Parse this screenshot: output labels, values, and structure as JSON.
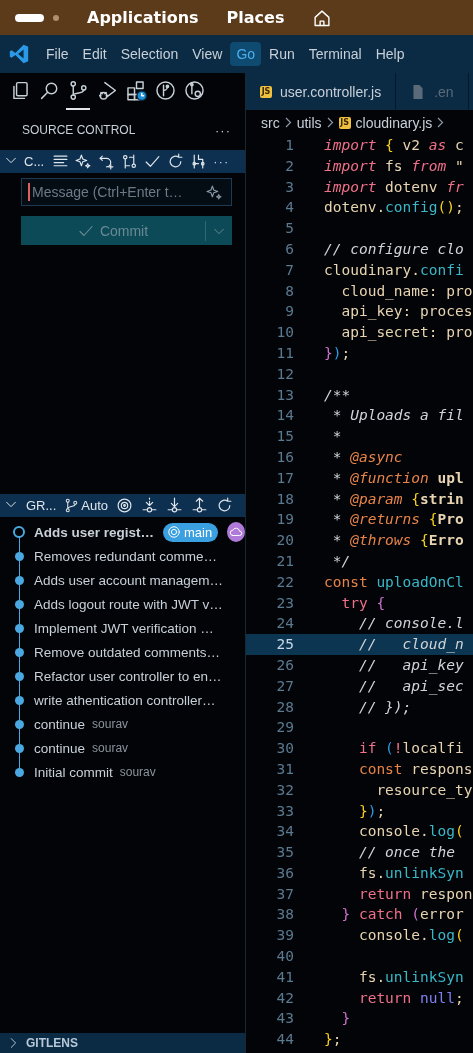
{
  "top_bar": {
    "menus": [
      "Applications",
      "Places"
    ]
  },
  "menu_bar": {
    "items": [
      {
        "label": "File",
        "selected": false
      },
      {
        "label": "Edit",
        "selected": false
      },
      {
        "label": "Selection",
        "selected": false
      },
      {
        "label": "View",
        "selected": false
      },
      {
        "label": "Go",
        "selected": true
      },
      {
        "label": "Run",
        "selected": false
      },
      {
        "label": "Terminal",
        "selected": false
      },
      {
        "label": "Help",
        "selected": false
      }
    ]
  },
  "activity_bar": {
    "items": [
      {
        "kind": "explorer",
        "selected": false
      },
      {
        "kind": "search",
        "selected": false
      },
      {
        "kind": "source_control",
        "selected": true
      },
      {
        "kind": "run",
        "selected": false
      },
      {
        "kind": "extensions",
        "selected": false
      },
      {
        "kind": "graph",
        "selected": false
      },
      {
        "kind": "inspect",
        "selected": false
      }
    ]
  },
  "source_control": {
    "title": "SOURCE CONTROL",
    "more": "···",
    "repo_header": {
      "expanded": true,
      "label": "C...",
      "more": "···"
    },
    "message": {
      "placeholder": "Message (Ctrl+Enter t…"
    },
    "commit_button": {
      "label": "Commit",
      "disabled": true
    }
  },
  "graph": {
    "header": {
      "expanded": true,
      "label": "GR...",
      "mode": "Auto"
    },
    "commits": [
      {
        "message": "Adds user regist…",
        "head": true,
        "branch": "main"
      },
      {
        "message": "Removes redundant comme…",
        "head": false
      },
      {
        "message": "Adds user account managem…",
        "head": false
      },
      {
        "message": "Adds logout route with JWT v…",
        "head": false
      },
      {
        "message": "Implement JWT verification …",
        "head": false
      },
      {
        "message": "Remove outdated comments…",
        "head": false
      },
      {
        "message": "Refactor user controller to en…",
        "head": false
      },
      {
        "message": "write athentication controller…",
        "head": false
      },
      {
        "message": "continue",
        "head": false,
        "author": "sourav"
      },
      {
        "message": "continue",
        "head": false,
        "author": "sourav"
      },
      {
        "message": "Initial commit",
        "head": false,
        "author": "sourav"
      }
    ]
  },
  "gitlens": {
    "label": "GITLENS",
    "expanded": false
  },
  "tabs": [
    {
      "label": "user.controller.js",
      "kind": "js",
      "icon_text": "JS",
      "selected": false
    },
    {
      "label": ".en",
      "kind": "file",
      "selected": false
    }
  ],
  "breadcrumb": [
    {
      "label": "src"
    },
    {
      "label": "utils"
    },
    {
      "label": "cloudinary.js",
      "icon_text": "JS"
    }
  ],
  "code_lines": [
    {
      "number": "1",
      "current": false,
      "tokens": [
        {
          "text": "import",
          "kind": "kw"
        },
        {
          "text": " {",
          "kind": "b1"
        },
        {
          "text": " v2 ",
          "kind": "id"
        },
        {
          "text": "as",
          "kind": "kw"
        },
        {
          "text": " c",
          "kind": "id"
        }
      ]
    },
    {
      "number": "2",
      "current": false,
      "tokens": [
        {
          "text": "import",
          "kind": "kw"
        },
        {
          "text": " fs ",
          "kind": "id"
        },
        {
          "text": "from",
          "kind": "kw"
        },
        {
          "text": " \"",
          "kind": "id"
        }
      ]
    },
    {
      "number": "3",
      "current": false,
      "tokens": [
        {
          "text": "import",
          "kind": "kw"
        },
        {
          "text": " dotenv ",
          "kind": "id"
        },
        {
          "text": "fr",
          "kind": "kw"
        }
      ]
    },
    {
      "number": "4",
      "current": false,
      "tokens": [
        {
          "text": "dotenv.",
          "kind": "id"
        },
        {
          "text": "config",
          "kind": "fn"
        },
        {
          "text": "()",
          "kind": "b1"
        },
        {
          "text": ";",
          "kind": "id"
        }
      ]
    },
    {
      "number": "5",
      "current": false
    },
    {
      "number": "6",
      "current": false,
      "tokens": [
        {
          "text": "// configure clo",
          "kind": "cm"
        }
      ]
    },
    {
      "number": "7",
      "current": false,
      "tokens": [
        {
          "text": "cloudinary.",
          "kind": "id"
        },
        {
          "text": "confi",
          "kind": "fn"
        }
      ]
    },
    {
      "number": "8",
      "current": false,
      "tokens": [
        {
          "text": "  cloud_name: pro",
          "kind": "id"
        }
      ]
    },
    {
      "number": "9",
      "current": false,
      "tokens": [
        {
          "text": "  api_key: proces",
          "kind": "id"
        }
      ]
    },
    {
      "number": "10",
      "current": false,
      "tokens": [
        {
          "text": "  api_secret: pro",
          "kind": "id"
        }
      ]
    },
    {
      "number": "11",
      "current": false,
      "tokens": [
        {
          "text": "}",
          "kind": "b2"
        },
        {
          "text": ")",
          "kind": "b3"
        },
        {
          "text": ";",
          "kind": "id"
        }
      ]
    },
    {
      "number": "12",
      "current": false
    },
    {
      "number": "13",
      "current": false,
      "tokens": [
        {
          "text": "/**",
          "kind": "cm"
        }
      ]
    },
    {
      "number": "14",
      "current": false,
      "tokens": [
        {
          "text": " * Uploads a fil",
          "kind": "cm"
        }
      ]
    },
    {
      "number": "15",
      "current": false,
      "tokens": [
        {
          "text": " *",
          "kind": "cm"
        }
      ]
    },
    {
      "number": "16",
      "current": false,
      "tokens": [
        {
          "text": " * ",
          "kind": "cm"
        },
        {
          "text": "@async",
          "kind": "tag"
        }
      ]
    },
    {
      "number": "17",
      "current": false,
      "tokens": [
        {
          "text": " * ",
          "kind": "cm"
        },
        {
          "text": "@function",
          "kind": "tag"
        },
        {
          "text": " upl",
          "kind": "ty"
        }
      ]
    },
    {
      "number": "18",
      "current": false,
      "tokens": [
        {
          "text": " * ",
          "kind": "cm"
        },
        {
          "text": "@param",
          "kind": "tag"
        },
        {
          "text": " {",
          "kind": "b1"
        },
        {
          "text": "strin",
          "kind": "ty"
        }
      ]
    },
    {
      "number": "19",
      "current": false,
      "tokens": [
        {
          "text": " * ",
          "kind": "cm"
        },
        {
          "text": "@returns",
          "kind": "tag"
        },
        {
          "text": " {",
          "kind": "b1"
        },
        {
          "text": "Pro",
          "kind": "ty"
        }
      ]
    },
    {
      "number": "20",
      "current": false,
      "tokens": [
        {
          "text": " * ",
          "kind": "cm"
        },
        {
          "text": "@throws",
          "kind": "tag"
        },
        {
          "text": " {",
          "kind": "b1"
        },
        {
          "text": "Erro",
          "kind": "ty"
        }
      ]
    },
    {
      "number": "21",
      "current": false,
      "tokens": [
        {
          "text": " */",
          "kind": "cm"
        }
      ]
    },
    {
      "number": "22",
      "current": false,
      "tokens": [
        {
          "text": "const",
          "kind": "cst"
        },
        {
          "text": " uploadOnCl",
          "kind": "fn"
        }
      ]
    },
    {
      "number": "23",
      "current": false,
      "tokens": [
        {
          "text": "  try",
          "kind": "ctl"
        },
        {
          "text": " {",
          "kind": "b2"
        }
      ]
    },
    {
      "number": "24",
      "current": false,
      "tokens": [
        {
          "text": "    // console.l",
          "kind": "cm"
        }
      ]
    },
    {
      "number": "25",
      "current": true,
      "tokens": [
        {
          "text": "    //   cloud_n",
          "kind": "cm"
        }
      ]
    },
    {
      "number": "26",
      "current": false,
      "tokens": [
        {
          "text": "    //   api_key",
          "kind": "cm"
        }
      ]
    },
    {
      "number": "27",
      "current": false,
      "tokens": [
        {
          "text": "    //   api_sec",
          "kind": "cm"
        }
      ]
    },
    {
      "number": "28",
      "current": false,
      "tokens": [
        {
          "text": "    // });",
          "kind": "cm"
        }
      ]
    },
    {
      "number": "29",
      "current": false
    },
    {
      "number": "30",
      "current": false,
      "tokens": [
        {
          "text": "    if",
          "kind": "ctl"
        },
        {
          "text": " (",
          "kind": "b3"
        },
        {
          "text": "!",
          "kind": "ctl"
        },
        {
          "text": "localfi",
          "kind": "id"
        }
      ]
    },
    {
      "number": "31",
      "current": false,
      "tokens": [
        {
          "text": "    const",
          "kind": "cst"
        },
        {
          "text": " respons",
          "kind": "id"
        }
      ]
    },
    {
      "number": "32",
      "current": false,
      "tokens": [
        {
          "text": "      resource_ty",
          "kind": "id"
        }
      ]
    },
    {
      "number": "33",
      "current": false,
      "tokens": [
        {
          "text": "    }",
          "kind": "b1"
        },
        {
          "text": ")",
          "kind": "b3"
        },
        {
          "text": ";",
          "kind": "id"
        }
      ]
    },
    {
      "number": "34",
      "current": false,
      "tokens": [
        {
          "text": "    console.",
          "kind": "id"
        },
        {
          "text": "log",
          "kind": "fn"
        },
        {
          "text": "(",
          "kind": "b1"
        }
      ]
    },
    {
      "number": "35",
      "current": false,
      "tokens": [
        {
          "text": "    // once the",
          "kind": "cm"
        }
      ]
    },
    {
      "number": "36",
      "current": false,
      "tokens": [
        {
          "text": "    fs.",
          "kind": "id"
        },
        {
          "text": "unlinkSyn",
          "kind": "fn"
        }
      ]
    },
    {
      "number": "37",
      "current": false,
      "tokens": [
        {
          "text": "    return",
          "kind": "ctl"
        },
        {
          "text": " respon",
          "kind": "id"
        }
      ]
    },
    {
      "number": "38",
      "current": false,
      "tokens": [
        {
          "text": "  }",
          "kind": "b2"
        },
        {
          "text": " catch",
          "kind": "ctl"
        },
        {
          "text": " (",
          "kind": "b2"
        },
        {
          "text": "error",
          "kind": "id"
        }
      ]
    },
    {
      "number": "39",
      "current": false,
      "tokens": [
        {
          "text": "    console.",
          "kind": "id"
        },
        {
          "text": "log",
          "kind": "fn"
        },
        {
          "text": "(",
          "kind": "b1"
        }
      ]
    },
    {
      "number": "40",
      "current": false
    },
    {
      "number": "41",
      "current": false,
      "tokens": [
        {
          "text": "    fs.",
          "kind": "id"
        },
        {
          "text": "unlinkSyn",
          "kind": "fn"
        }
      ]
    },
    {
      "number": "42",
      "current": false,
      "tokens": [
        {
          "text": "    return",
          "kind": "ctl"
        },
        {
          "text": " null",
          "kind": "nul"
        },
        {
          "text": ";",
          "kind": "id"
        }
      ]
    },
    {
      "number": "43",
      "current": false,
      "tokens": [
        {
          "text": "  }",
          "kind": "b2"
        }
      ]
    },
    {
      "number": "44",
      "current": false,
      "tokens": [
        {
          "text": "}",
          "kind": "b1"
        },
        {
          "text": ";",
          "kind": "id"
        }
      ]
    }
  ]
}
